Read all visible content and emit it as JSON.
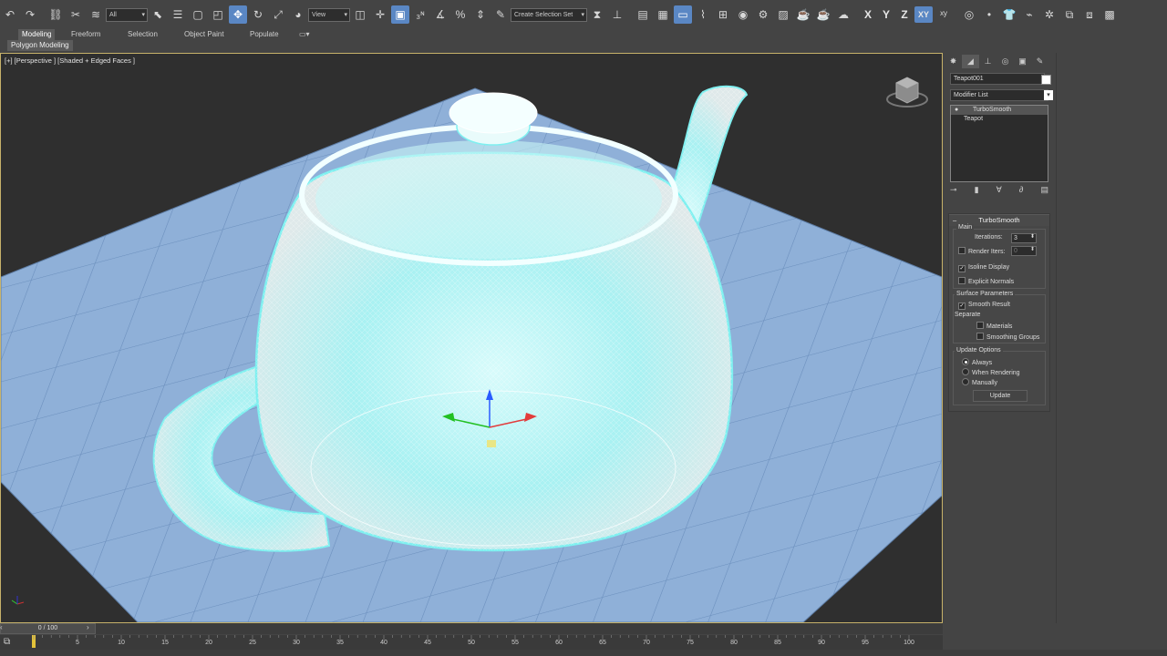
{
  "toolbar": {
    "selection_filter": "All",
    "ref_coord": "View",
    "named_selection": "Create Selection Set",
    "axes": [
      "X",
      "Y",
      "Z",
      "XY"
    ]
  },
  "ribbon": {
    "tabs": [
      "Modeling",
      "Freeform",
      "Selection",
      "Object Paint",
      "Populate"
    ],
    "active_tab": "Modeling",
    "sub_label": "Polygon Modeling"
  },
  "viewport": {
    "label": "[+] [Perspective ] [Shaded + Edged Faces ]"
  },
  "command_panel": {
    "object_name": "Teapot001",
    "modifier_list": "Modifier List",
    "stack": [
      "TurboSmooth",
      "Teapot"
    ],
    "rollout_title": "TurboSmooth",
    "main_label": "Main",
    "iterations_label": "Iterations:",
    "iterations_value": "3",
    "render_iters_label": "Render Iters:",
    "render_iters_value": "0",
    "isoline_display": "Isoline Display",
    "explicit_normals": "Explicit Normals",
    "surface_params": "Surface Parameters",
    "smooth_result": "Smooth Result",
    "separate": "Separate",
    "materials": "Materials",
    "smoothing_groups": "Smoothing Groups",
    "update_options": "Update Options",
    "always": "Always",
    "when_rendering": "When Rendering",
    "manually": "Manually",
    "update_button": "Update"
  },
  "timeline": {
    "frame_display": "0 / 100",
    "ticks": [
      "5",
      "10",
      "15",
      "20",
      "25",
      "30",
      "35",
      "40",
      "45",
      "50",
      "55",
      "60",
      "65",
      "70",
      "75",
      "80",
      "85",
      "90",
      "95",
      "100"
    ]
  },
  "colors": {
    "accent": "#5a87c4",
    "viewport_border": "#c7b26a",
    "grid": "#8fb0d8",
    "teapot_selection": "#7ff0f0"
  }
}
